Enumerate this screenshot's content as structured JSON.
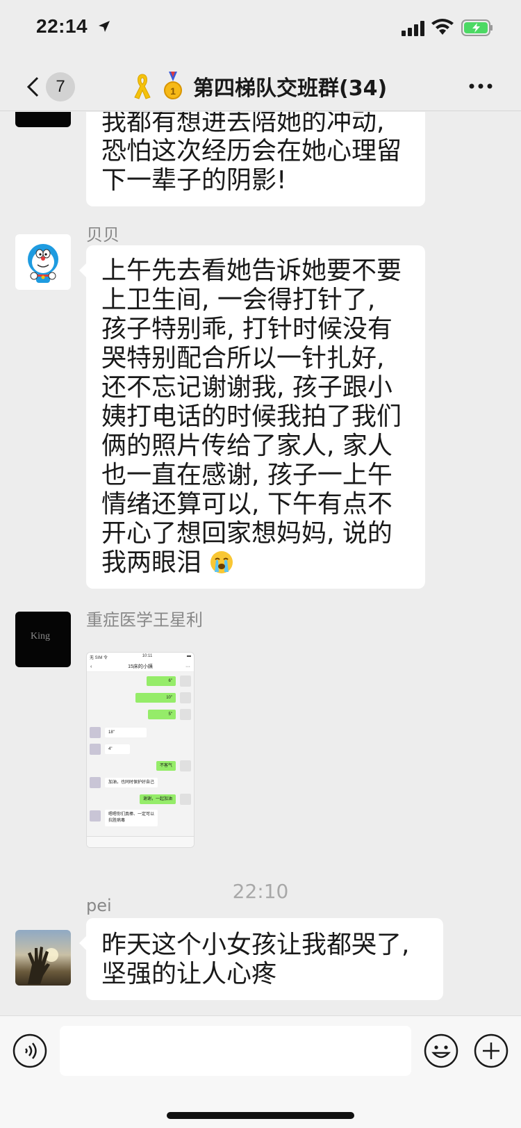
{
  "status_bar": {
    "time": "22:14",
    "location_icon": "location-arrow-icon",
    "signal_icon": "cellular-signal-icon",
    "wifi_icon": "wifi-icon",
    "battery_icon": "battery-charging-icon"
  },
  "nav": {
    "unread_count": "7",
    "title": "第四梯队交班群(34)",
    "back_icon": "chevron-left-icon",
    "more_icon": "more-dots-icon",
    "ribbon_icon": "yellow-ribbon-icon",
    "medal_icon": "medal-icon"
  },
  "messages": [
    {
      "sender": "",
      "avatar": "black-avatar",
      "lines": [
        "我都有想进去陪她的冲动,",
        "恐怕这次经历会在她心理留",
        "下一辈子的阴影!"
      ]
    },
    {
      "sender": "贝贝",
      "avatar": "doraemon-avatar",
      "lines": [
        "上午先去看她告诉她要不要",
        "上卫生间, 一会得打针了,",
        "孩子特别乖, 打针时候没有",
        "哭特别配合所以一针扎好,",
        "还不忘记谢谢我, 孩子跟小",
        "姨打电话的时候我拍了我们",
        "俩的照片传给了家人, 家人",
        "也一直在感谢, 孩子一上午",
        "情绪还算可以, 下午有点不",
        "开心了想回家想妈妈, 说的",
        "我两眼泪"
      ],
      "emoji_icon": "crying-face-icon"
    },
    {
      "sender": "重症医学王星利",
      "avatar": "king-avatar",
      "avatar_text": "King",
      "image": {
        "status_left": "无 SIM 令",
        "status_time": "10:11",
        "title": "15床的小姨",
        "items": [
          {
            "from": "me",
            "text": "6\""
          },
          {
            "from": "me",
            "text": "10\""
          },
          {
            "from": "me",
            "text": "5\""
          },
          {
            "from": "other",
            "text": "18\""
          },
          {
            "from": "other",
            "text": "4\""
          },
          {
            "from": "me",
            "text": "不客气"
          },
          {
            "from": "other",
            "text": "加油，也同时保护好自己"
          },
          {
            "from": "me",
            "text": "谢谢，一起加油"
          },
          {
            "from": "other",
            "text": "嗯嗯你们真棒、一定可以"
          },
          {
            "from": "other",
            "text": "抗胜病毒"
          }
        ]
      }
    },
    {
      "sender": "pei",
      "avatar": "hand-sunset-avatar",
      "lines": [
        "昨天这个小女孩让我都哭了,",
        "坚强的让人心疼"
      ]
    }
  ],
  "timestamp": "22:10",
  "input_bar": {
    "voice_icon": "voice-input-icon",
    "emoji_icon": "emoji-smile-icon",
    "plus_icon": "plus-circle-icon",
    "placeholder": ""
  }
}
